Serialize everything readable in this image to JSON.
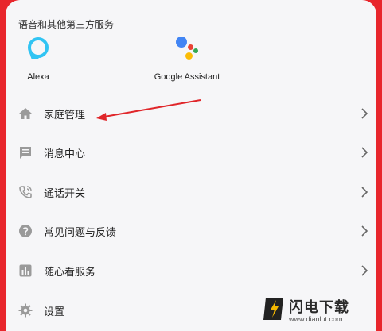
{
  "section_title": "语音和其他第三方服务",
  "services": [
    {
      "name": "Alexa",
      "icon": "alexa-icon"
    },
    {
      "name": "Google Assistant",
      "icon": "google-assistant-icon"
    }
  ],
  "menu": [
    {
      "label": "家庭管理",
      "icon": "home-icon"
    },
    {
      "label": "消息中心",
      "icon": "message-icon"
    },
    {
      "label": "通话开关",
      "icon": "phone-icon"
    },
    {
      "label": "常见问题与反馈",
      "icon": "help-icon"
    },
    {
      "label": "随心看服务",
      "icon": "chart-icon"
    },
    {
      "label": "设置",
      "icon": "gear-icon"
    }
  ],
  "watermark": {
    "title": "闪电下载",
    "url": "www.dianlut.com"
  },
  "colors": {
    "header_red": "#e8262c",
    "background": "#f6f6f8",
    "icon_gray": "#9a9a9a",
    "arrow_red": "#e0262a",
    "alexa_blue": "#31c4f3",
    "google_blue": "#4285f4",
    "google_red": "#ea4335",
    "google_yellow": "#fbbc05",
    "google_green": "#34a853"
  }
}
